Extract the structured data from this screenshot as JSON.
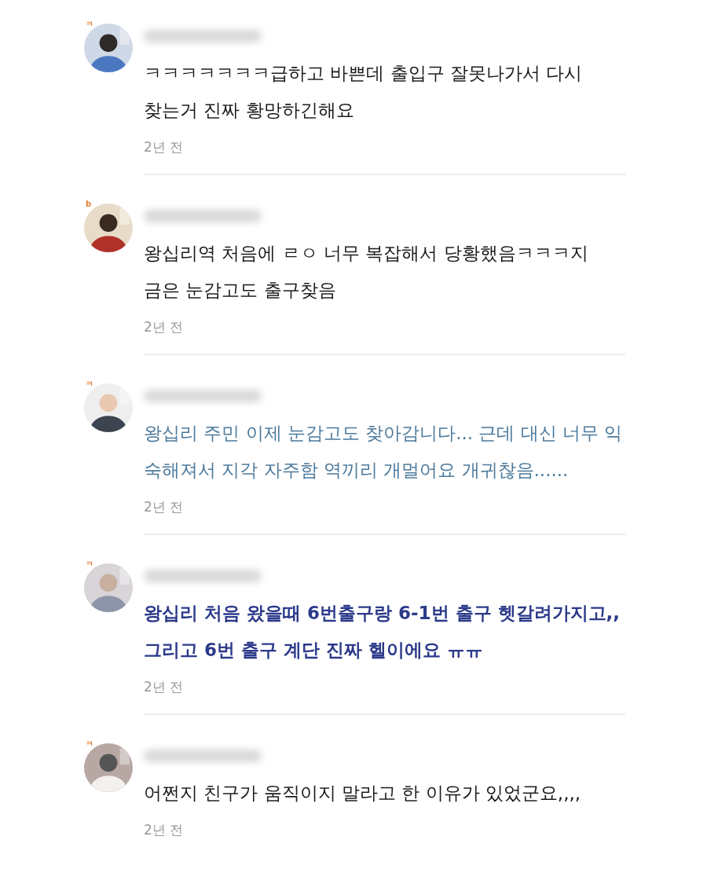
{
  "comments": [
    {
      "badge": "ㅋ",
      "kind": "plain",
      "lines": [
        "ㅋㅋㅋㅋㅋㅋㅋ급하고 바쁜데 출입구 잘못나가서 다시",
        "찾는거 진짜 황망하긴해요"
      ],
      "time": "2년 전"
    },
    {
      "badge": "b",
      "kind": "plain",
      "lines": [
        "왕십리역 처음에 ㄹㅇ 너무 복잡해서 당황했음ㅋㅋㅋ지",
        "금은 눈감고도 출구찾음"
      ],
      "time": "2년 전"
    },
    {
      "badge": "ㅋ",
      "kind": "blue",
      "lines": [
        "왕십리 주민 이제 눈감고도 찾아감니다... 근데 대신 너무 익",
        "숙해져서 지각 자주함 역끼리 개멀어요 개귀찮음......"
      ],
      "time": "2년 전"
    },
    {
      "badge": "ㅋ",
      "kind": "bold",
      "lines": [
        "왕십리 처음 왔을때 6번출구랑 6-1번 출구 헷갈려가지고,,",
        "그리고 6번 출구 계단 진짜 헬이에요 ㅠㅠ"
      ],
      "time": "2년 전"
    },
    {
      "badge": "ㅋ",
      "kind": "plain",
      "lines": [
        "어쩐지 친구가 움직이지 말라고 한 이유가 있었군요,,,,"
      ],
      "time": "2년 전"
    }
  ]
}
